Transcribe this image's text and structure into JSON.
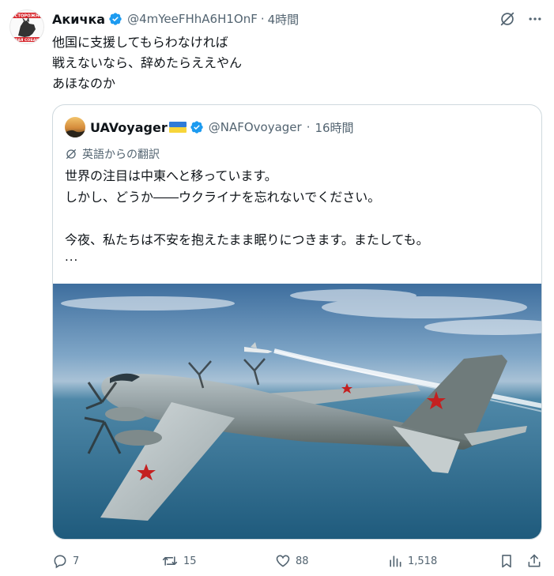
{
  "tweet": {
    "author_name": "Акичка",
    "handle": "@4mYeeFHhA6H1OnF",
    "separator": "·",
    "time": "4時間",
    "text": "他国に支援してもらわなければ\n戦えないなら、辞めたらええやん\nあほなのか",
    "avatar_text_top": "ОСТОРОЖНО",
    "avatar_text_bottom": "ЗЛАЯ СОБАКА"
  },
  "quote": {
    "author_name": "UAVoyager",
    "handle": "@NAFOvoyager",
    "separator": "·",
    "time": "16時間",
    "translation_label": "英語からの翻訳",
    "text": "世界の注目は中東へと移っています。\nしかし、どうか――ウクライナを忘れないでください。\n\n今夜、私たちは不安を抱えたまま眠りにつきます。またしても。",
    "more": "..."
  },
  "actions": {
    "replies": "7",
    "reposts": "15",
    "likes": "88",
    "views": "1,518"
  },
  "icons": {
    "verified": "verified-badge-icon",
    "grok": "grok-icon",
    "more": "more-icon",
    "reply": "reply-icon",
    "repost": "repost-icon",
    "like": "like-icon",
    "views": "views-icon",
    "bookmark": "bookmark-icon",
    "share": "share-icon"
  },
  "colors": {
    "verified_blue": "#1d9bf0",
    "muted_text": "#536471",
    "border": "#cfd9de"
  }
}
